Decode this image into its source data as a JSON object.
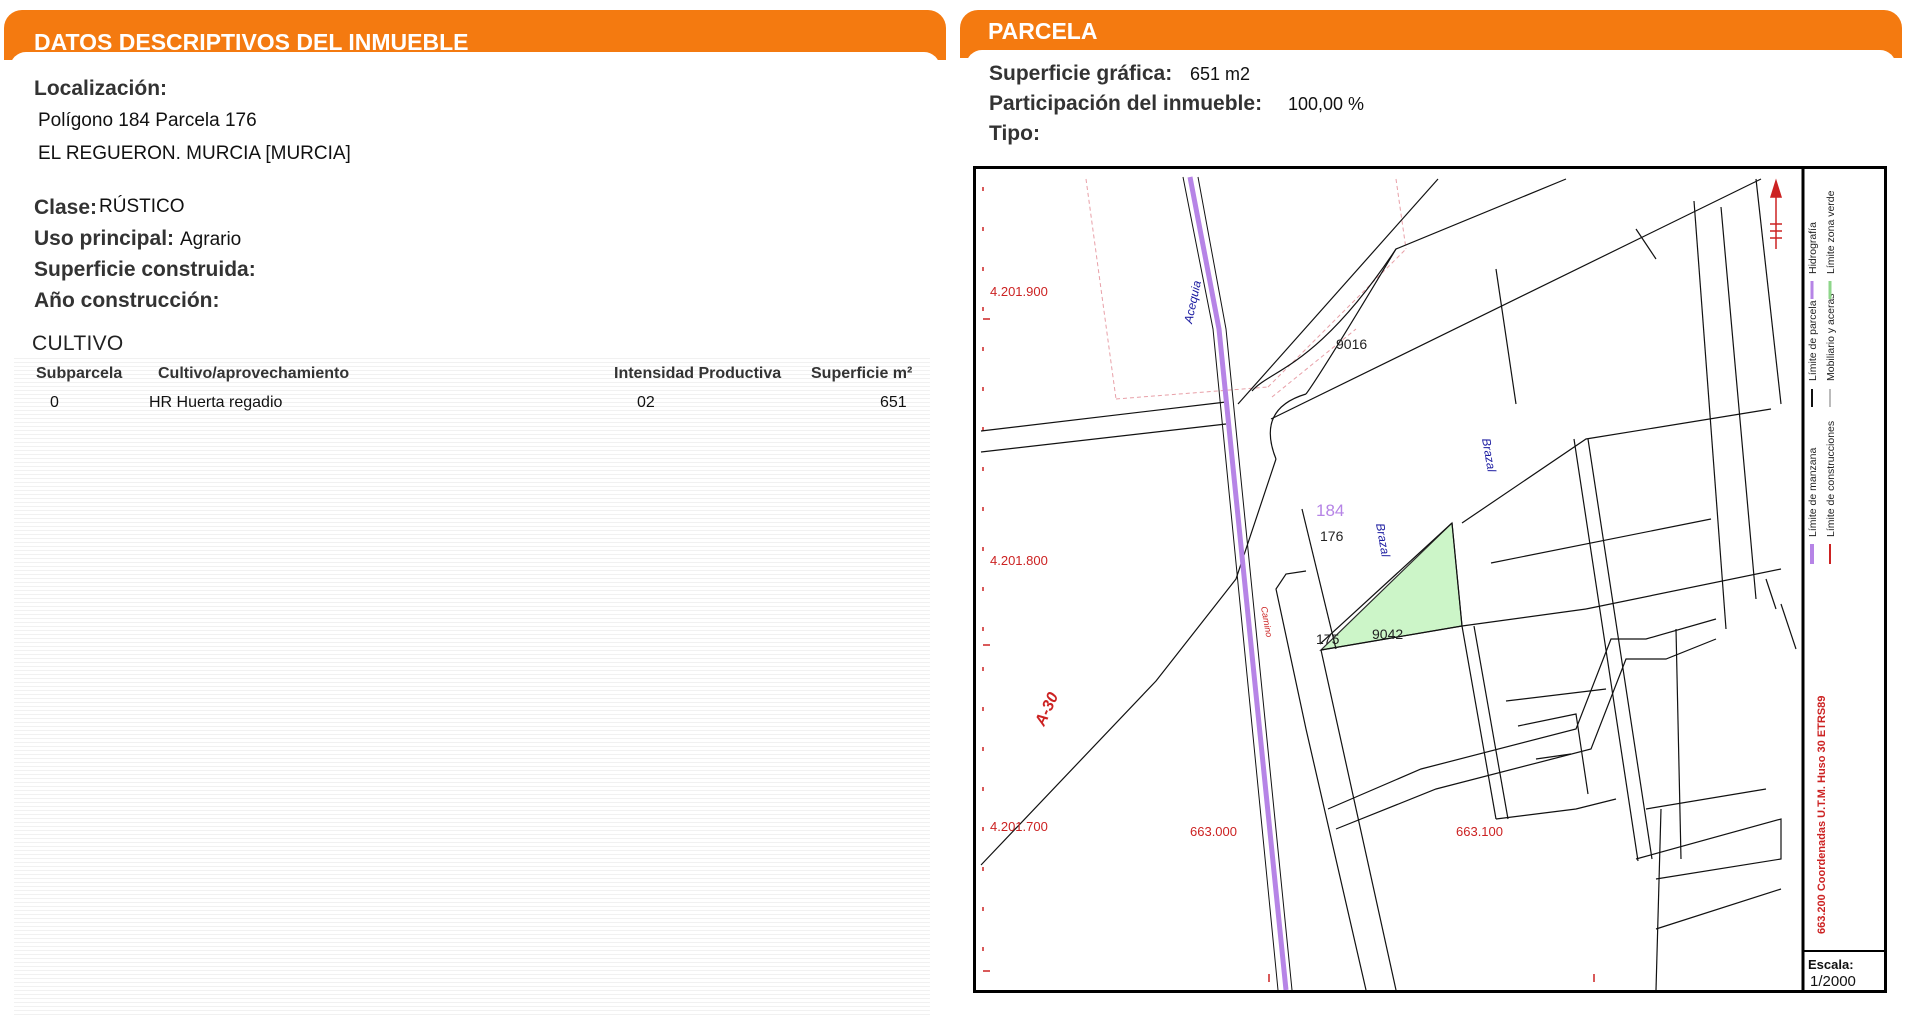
{
  "left_panel": {
    "header": "DATOS DESCRIPTIVOS DEL INMUEBLE",
    "localizacion_label": "Localización:",
    "localizacion_line1": "Polígono 184 Parcela 176",
    "localizacion_line2": "EL REGUERON. MURCIA [MURCIA]",
    "clase_label": "Clase:",
    "clase_value": "RÚSTICO",
    "uso_label": "Uso principal:",
    "uso_value": "Agrario",
    "superficie_construida_label": "Superficie construida:",
    "anio_label": "Año construcción:"
  },
  "cultivo": {
    "title": "CULTIVO",
    "columns": [
      "Subparcela",
      "Cultivo/aprovechamiento",
      "Intensidad Productiva",
      "Superficie m²"
    ],
    "rows": [
      {
        "subparcela": "0",
        "cultivo": "HR Huerta regadio",
        "intensidad": "02",
        "superficie": "651"
      }
    ]
  },
  "right_panel": {
    "header": "PARCELA",
    "superficie_grafica_label": "Superficie gráfica:",
    "superficie_grafica_value": "651 m2",
    "participacion_label": "Participación del inmueble:",
    "participacion_value": "100,00 %",
    "tipo_label": "Tipo:"
  },
  "map": {
    "y_coords": [
      "4.201.900",
      "4.201.800",
      "4.201.700"
    ],
    "x_coords": [
      "663.000",
      "663.100"
    ],
    "parcels": [
      "9016",
      "184",
      "176",
      "175",
      "9042"
    ],
    "road_labels": [
      "Acequia",
      "Brazal",
      "Brazal",
      "Camino",
      "A-30"
    ],
    "legend": [
      "Límite de manzana",
      "Límite de construcciones",
      "Límite de parcela",
      "Mobiliario y aceras",
      "Hidrografía",
      "Límite zona verde"
    ],
    "crs_text": "663.200 Coordenadas U.T.M. Huso 30 ETRS89",
    "escala_label": "Escala:",
    "escala_value": "1/2000",
    "colors": {
      "accent": "#f47a10",
      "green_zone": "#ccf5c8",
      "acequia": "#b684e6",
      "coords": "#cc2222"
    }
  }
}
